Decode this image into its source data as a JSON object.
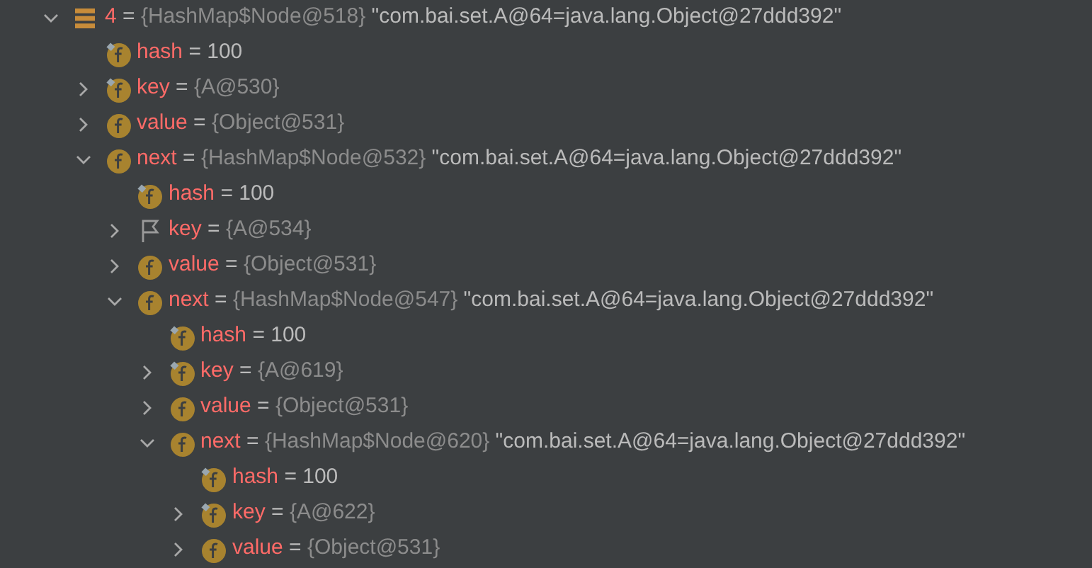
{
  "tree": [
    {
      "kind": "array",
      "name": "4",
      "sep": "=",
      "ref": "{HashMap$Node@518}",
      "value": "\"com.bai.set.A@64=java.lang.Object@27ddd392\"",
      "expanded": true,
      "children": [
        {
          "kind": "final-field",
          "name": "hash",
          "sep": "=",
          "value": "100"
        },
        {
          "kind": "final-field",
          "name": "key",
          "sep": "=",
          "ref": "{A@530}",
          "expanded": false
        },
        {
          "kind": "field",
          "name": "value",
          "sep": "=",
          "ref": "{Object@531}",
          "expanded": false
        },
        {
          "kind": "field",
          "name": "next",
          "sep": "=",
          "ref": "{HashMap$Node@532}",
          "value": "\"com.bai.set.A@64=java.lang.Object@27ddd392\"",
          "expanded": true,
          "children": [
            {
              "kind": "final-field",
              "name": "hash",
              "sep": "=",
              "value": "100"
            },
            {
              "kind": "flagged",
              "name": "key",
              "sep": "=",
              "ref": "{A@534}",
              "expanded": false
            },
            {
              "kind": "field",
              "name": "value",
              "sep": "=",
              "ref": "{Object@531}",
              "expanded": false
            },
            {
              "kind": "field",
              "name": "next",
              "sep": "=",
              "ref": "{HashMap$Node@547}",
              "value": "\"com.bai.set.A@64=java.lang.Object@27ddd392\"",
              "expanded": true,
              "children": [
                {
                  "kind": "final-field",
                  "name": "hash",
                  "sep": "=",
                  "value": "100"
                },
                {
                  "kind": "final-field",
                  "name": "key",
                  "sep": "=",
                  "ref": "{A@619}",
                  "expanded": false
                },
                {
                  "kind": "field",
                  "name": "value",
                  "sep": "=",
                  "ref": "{Object@531}",
                  "expanded": false
                },
                {
                  "kind": "field",
                  "name": "next",
                  "sep": "=",
                  "ref": "{HashMap$Node@620}",
                  "value": "\"com.bai.set.A@64=java.lang.Object@27ddd392\"",
                  "expanded": true,
                  "children": [
                    {
                      "kind": "final-field",
                      "name": "hash",
                      "sep": "=",
                      "value": "100"
                    },
                    {
                      "kind": "final-field",
                      "name": "key",
                      "sep": "=",
                      "ref": "{A@622}",
                      "expanded": false
                    },
                    {
                      "kind": "field",
                      "name": "value",
                      "sep": "=",
                      "ref": "{Object@531}",
                      "expanded": false
                    }
                  ]
                }
              ]
            }
          ]
        }
      ]
    }
  ]
}
